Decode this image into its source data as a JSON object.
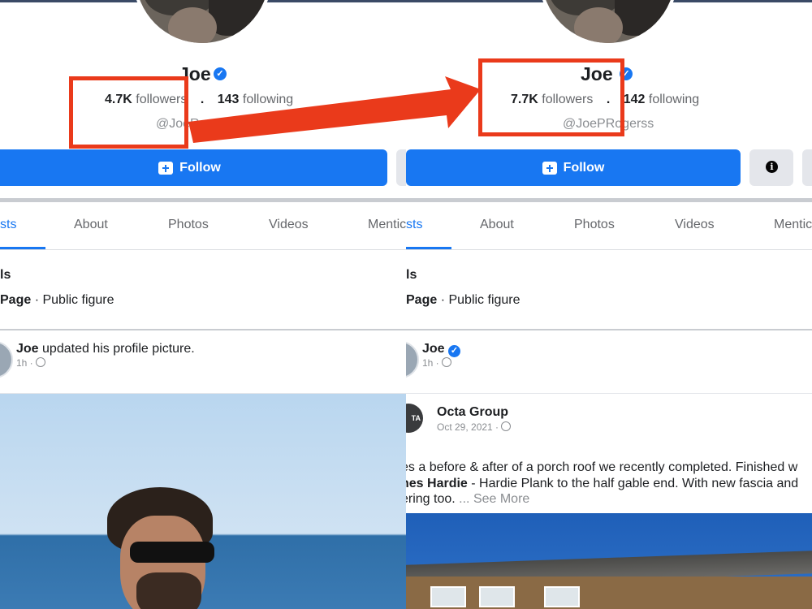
{
  "left": {
    "name": "Joe",
    "followers_count": "4.7K",
    "followers_label": "followers",
    "following_count": "143",
    "following_label": "following",
    "handle": "@JoeRogersUK",
    "follow_button": "Follow",
    "tabs": [
      "sts",
      "About",
      "Photos",
      "Videos",
      "Mentic"
    ],
    "section_title": "ls",
    "page_label": "Page",
    "page_category": "· Public figure",
    "post_author": "Joe",
    "post_action": "updated his profile picture.",
    "post_time": "1h ·"
  },
  "right": {
    "name": "Joe",
    "followers_count": "7.7K",
    "followers_label": "followers",
    "following_count": "142",
    "following_label": "following",
    "handle": "@JoePRogerss",
    "follow_button": "Follow",
    "tabs": [
      "sts",
      "About",
      "Photos",
      "Videos",
      "Mentic"
    ],
    "section_title": "ls",
    "page_label": "Page",
    "page_category": "· Public figure",
    "post_author": "Joe",
    "post_time": "1h ·",
    "shared_author": "Octa Group",
    "shared_avatar_text": "TA",
    "shared_date": "Oct 29, 2021 ·",
    "post_text_line1": "es a before & after of a porch roof we recently completed. Finished w",
    "post_text_bold": "nes Hardie",
    "post_text_line2": " - Hardie Plank to the half gable end. With new fascia and",
    "post_text_line3": "ering too. ",
    "see_more": "... See More"
  },
  "colors": {
    "accent": "#1877f2",
    "annotation": "#ea3a1b"
  },
  "icons": [
    "verified-badge-icon",
    "follow-page-icon",
    "info-icon",
    "globe-icon",
    "arrow-icon"
  ]
}
